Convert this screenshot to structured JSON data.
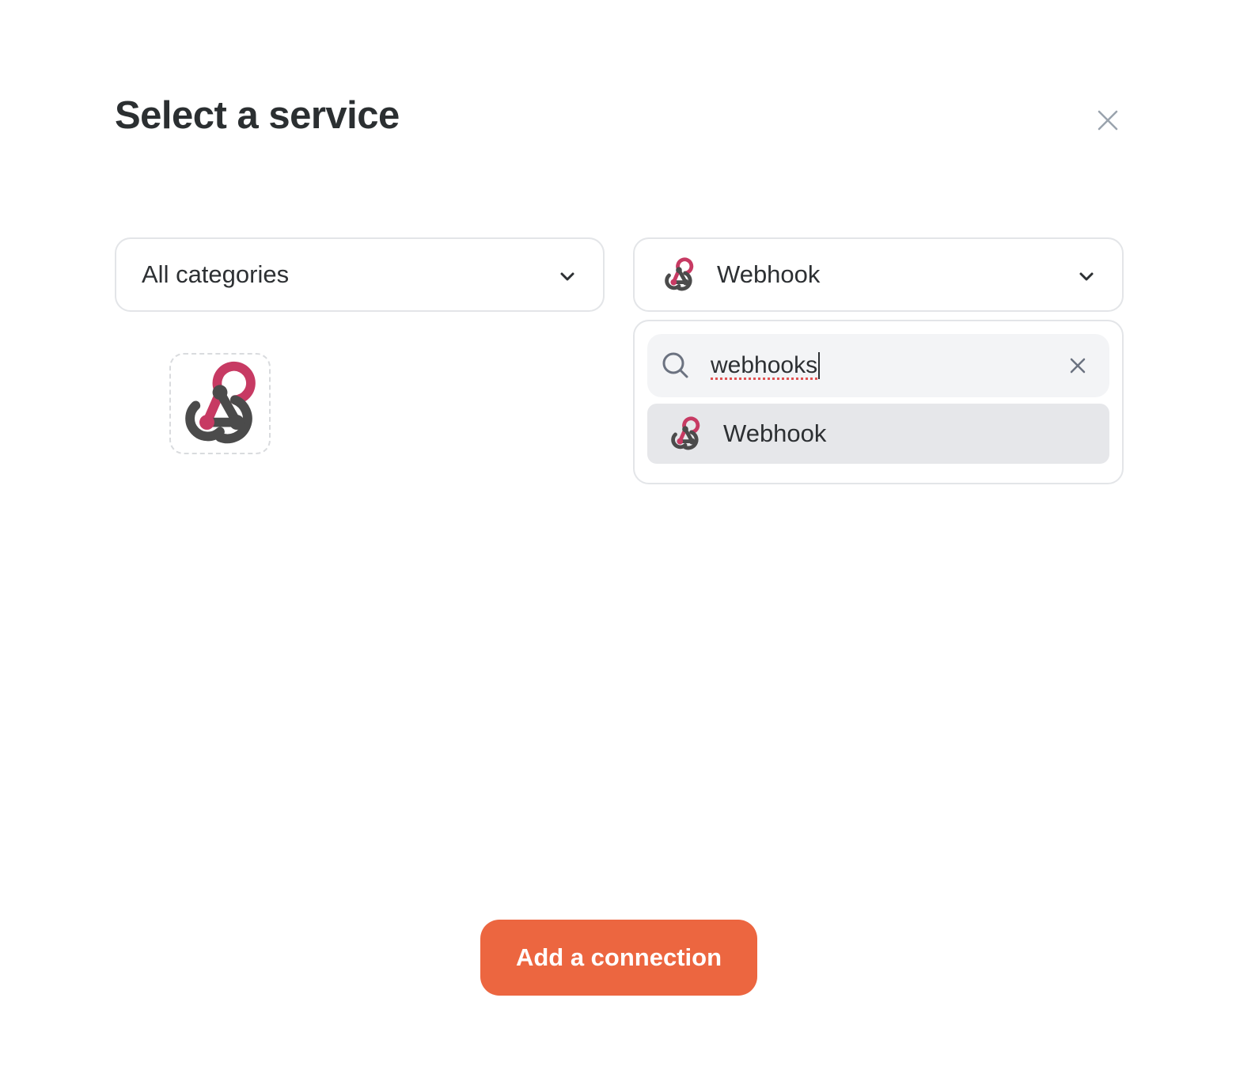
{
  "modal": {
    "title": "Select a service"
  },
  "category_select": {
    "selected": "All categories"
  },
  "service_select": {
    "selected": "Webhook",
    "icon": "webhook-icon"
  },
  "search": {
    "value": "webhooks"
  },
  "results": [
    {
      "label": "Webhook",
      "icon": "webhook-icon"
    }
  ],
  "tiles": [
    {
      "icon": "webhook-icon"
    }
  ],
  "footer": {
    "add_label": "Add a connection"
  },
  "colors": {
    "accent": "#ec6640",
    "webhook_red": "#c73a63",
    "webhook_dark": "#4b4b4b"
  }
}
